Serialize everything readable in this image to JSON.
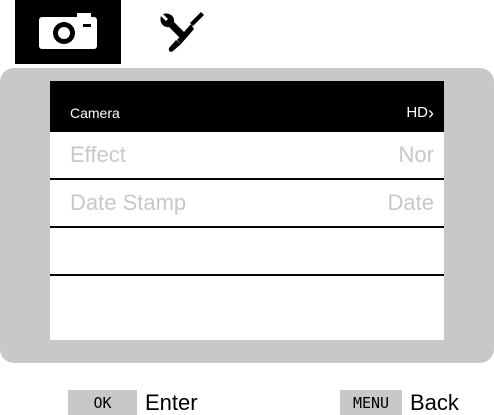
{
  "tabs": [
    {
      "icon": "camera-icon",
      "active": true
    },
    {
      "icon": "tools-icon",
      "active": false
    }
  ],
  "menu": {
    "header": {
      "label": "Camera",
      "value": "HD",
      "chevron": "›"
    },
    "rows": [
      {
        "label": "Effect",
        "value": "Nor"
      },
      {
        "label": "Date Stamp",
        "value": "Date"
      },
      {
        "label": "",
        "value": ""
      },
      {
        "label": "",
        "value": ""
      }
    ]
  },
  "hints": {
    "ok_key": "OK",
    "ok_label": "Enter",
    "menu_key": "MENU",
    "menu_label": "Back"
  },
  "colors": {
    "panel": "#c8c8c8",
    "active_tab": "#000000",
    "header_bg": "#000000",
    "inactive_text": "#c8c8c8"
  }
}
